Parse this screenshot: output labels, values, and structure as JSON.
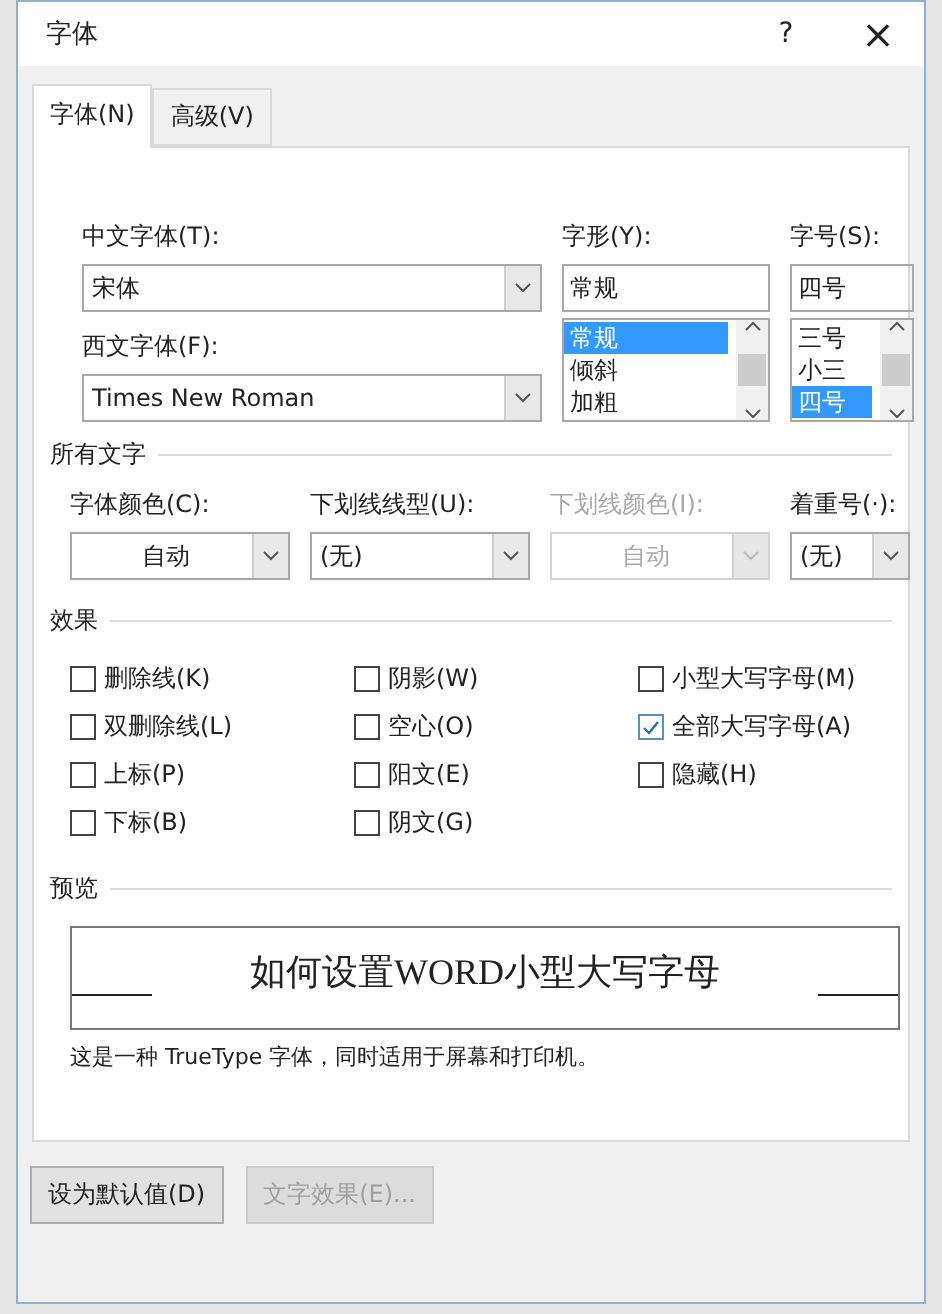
{
  "window": {
    "title": "字体",
    "help": "?",
    "close": "×"
  },
  "tabs": [
    {
      "label": "字体(N)",
      "selected": true
    },
    {
      "label": "高级(V)",
      "selected": false
    }
  ],
  "fonts": {
    "chinese": {
      "label": "中文字体(T):",
      "value": "宋体"
    },
    "western": {
      "label": "西文字体(F):",
      "value": "Times New Roman"
    }
  },
  "style": {
    "label": "字形(Y):",
    "value": "常规",
    "items": [
      {
        "label": "常规",
        "selected": true
      },
      {
        "label": "倾斜",
        "selected": false
      },
      {
        "label": "加粗",
        "selected": false
      }
    ]
  },
  "size": {
    "label": "字号(S):",
    "value": "四号",
    "items": [
      {
        "label": "三号",
        "selected": false
      },
      {
        "label": "小三",
        "selected": false
      },
      {
        "label": "四号",
        "selected": true
      }
    ]
  },
  "all_text": {
    "heading": "所有文字",
    "dropdowns": [
      {
        "label": "字体颜色(C):",
        "value": "自动",
        "disabled": false,
        "centered": true
      },
      {
        "label": "下划线线型(U):",
        "value": "(无)",
        "disabled": false,
        "centered": false
      },
      {
        "label": "下划线颜色(I):",
        "value": "自动",
        "disabled": true,
        "centered": true
      },
      {
        "label": "着重号(·):",
        "value": "(无)",
        "disabled": false,
        "centered": false
      }
    ]
  },
  "effects": {
    "heading": "效果",
    "checkboxes": [
      {
        "label": "删除线(K)",
        "checked": false
      },
      {
        "label": "阴影(W)",
        "checked": false
      },
      {
        "label": "小型大写字母(M)",
        "checked": false
      },
      {
        "label": "双删除线(L)",
        "checked": false
      },
      {
        "label": "空心(O)",
        "checked": false
      },
      {
        "label": "全部大写字母(A)",
        "checked": true
      },
      {
        "label": "上标(P)",
        "checked": false
      },
      {
        "label": "阳文(E)",
        "checked": false
      },
      {
        "label": "隐藏(H)",
        "checked": false
      },
      {
        "label": "下标(B)",
        "checked": false
      },
      {
        "label": "阴文(G)",
        "checked": false
      }
    ]
  },
  "preview": {
    "heading": "预览",
    "sample": "如何设置WORD小型大写字母",
    "note": "这是一种 TrueType 字体，同时适用于屏幕和打印机。"
  },
  "buttons": [
    {
      "label": "设为默认值(D)",
      "disabled": false
    },
    {
      "label": "文字效果(E)...",
      "disabled": true
    }
  ]
}
